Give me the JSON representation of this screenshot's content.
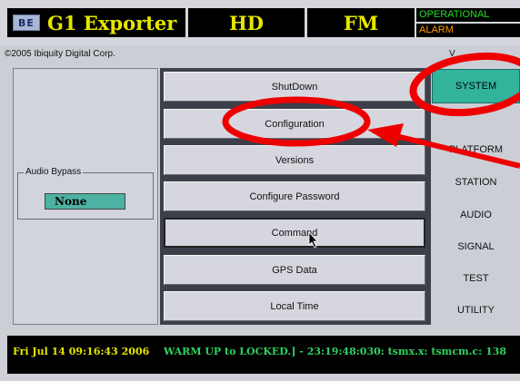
{
  "header": {
    "logo_text": "BE",
    "app_title": "G1 Exporter",
    "hd_label": "HD",
    "fm_label": "FM",
    "status_operational": "OPERATIONAL",
    "status_alarm": "ALARM"
  },
  "copyright": "©2005 Ibiquity Digital Corp.",
  "version_label_visible": "V",
  "left_panel": {
    "audio_bypass_label": "Audio Bypass",
    "audio_bypass_value": "None"
  },
  "buttons": [
    {
      "label": "ShutDown"
    },
    {
      "label": "Configuration"
    },
    {
      "label": "Versions"
    },
    {
      "label": "Configure Password"
    },
    {
      "label": "Command"
    },
    {
      "label": "GPS Data"
    },
    {
      "label": "Local Time"
    }
  ],
  "nav": {
    "items": [
      {
        "label": "SYSTEM",
        "active": true
      },
      {
        "label": "",
        "active": false
      },
      {
        "label": "PLATFORM",
        "active": false
      },
      {
        "label": "STATION",
        "active": false
      },
      {
        "label": "AUDIO",
        "active": false
      },
      {
        "label": "SIGNAL",
        "active": false
      },
      {
        "label": "TEST",
        "active": false
      },
      {
        "label": "UTILITY",
        "active": false
      }
    ]
  },
  "footer": {
    "clock": "Fri Jul 14 09:16:43 2006",
    "log_line": "WARM UP to LOCKED.]  -  23:19:48:030: tsmx.x: tsmcm.c: 138"
  },
  "colors": {
    "accent_teal": "#32b39c",
    "header_yellow": "#e6e600",
    "status_green": "#22dd22",
    "status_orange": "#ff9900",
    "annotation_red": "#ee0000"
  },
  "icons": {
    "cursor": "mouse-pointer-icon",
    "annotation_arrow": "red-arrow-icon",
    "annotation_circles": "red-ellipse-highlight"
  }
}
